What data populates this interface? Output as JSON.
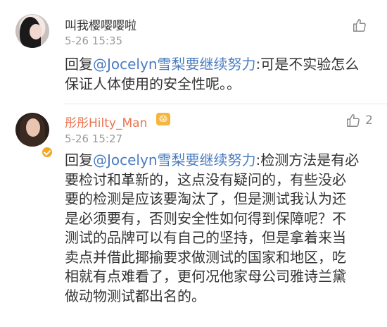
{
  "comments": [
    {
      "username": "叫我樱嘤嘤啦",
      "time": "5-26 15:35",
      "like_count": "",
      "reply_prefix": "回复",
      "mention": "@Jocelyn雪梨要继续努力",
      "text": ":可是不实验怎么\n保证人体使用的安全性呢。。"
    },
    {
      "username": "彤彤Hilty_Man",
      "badge": "😱",
      "time": "5-26 15:27",
      "like_count": "2",
      "reply_prefix": "回复",
      "mention": "@Jocelyn雪梨要继续努力",
      "text": ":检测方法是有必\n要检讨和革新的，这点没有疑问的，有些没必\n要的检测是应该要淘汰了，但是测试我认为还\n是必须要有，否则安全性如何得到保障呢？不\n测试的品牌可以有自己的坚持，但是拿着来当\n卖点并借此揶揄要求做测试的国家和地区，吃\n相就有点难看了，更何况他家母公司雅诗兰黛\n做动物测试都出名的。"
    }
  ],
  "colors": {
    "mention": "#4a7cc0",
    "username_vip": "#eb7350",
    "time": "#9a9a9a",
    "text": "#333333"
  },
  "icons": {
    "like": "thumb-up-icon",
    "verified": "verified-badge-icon"
  }
}
